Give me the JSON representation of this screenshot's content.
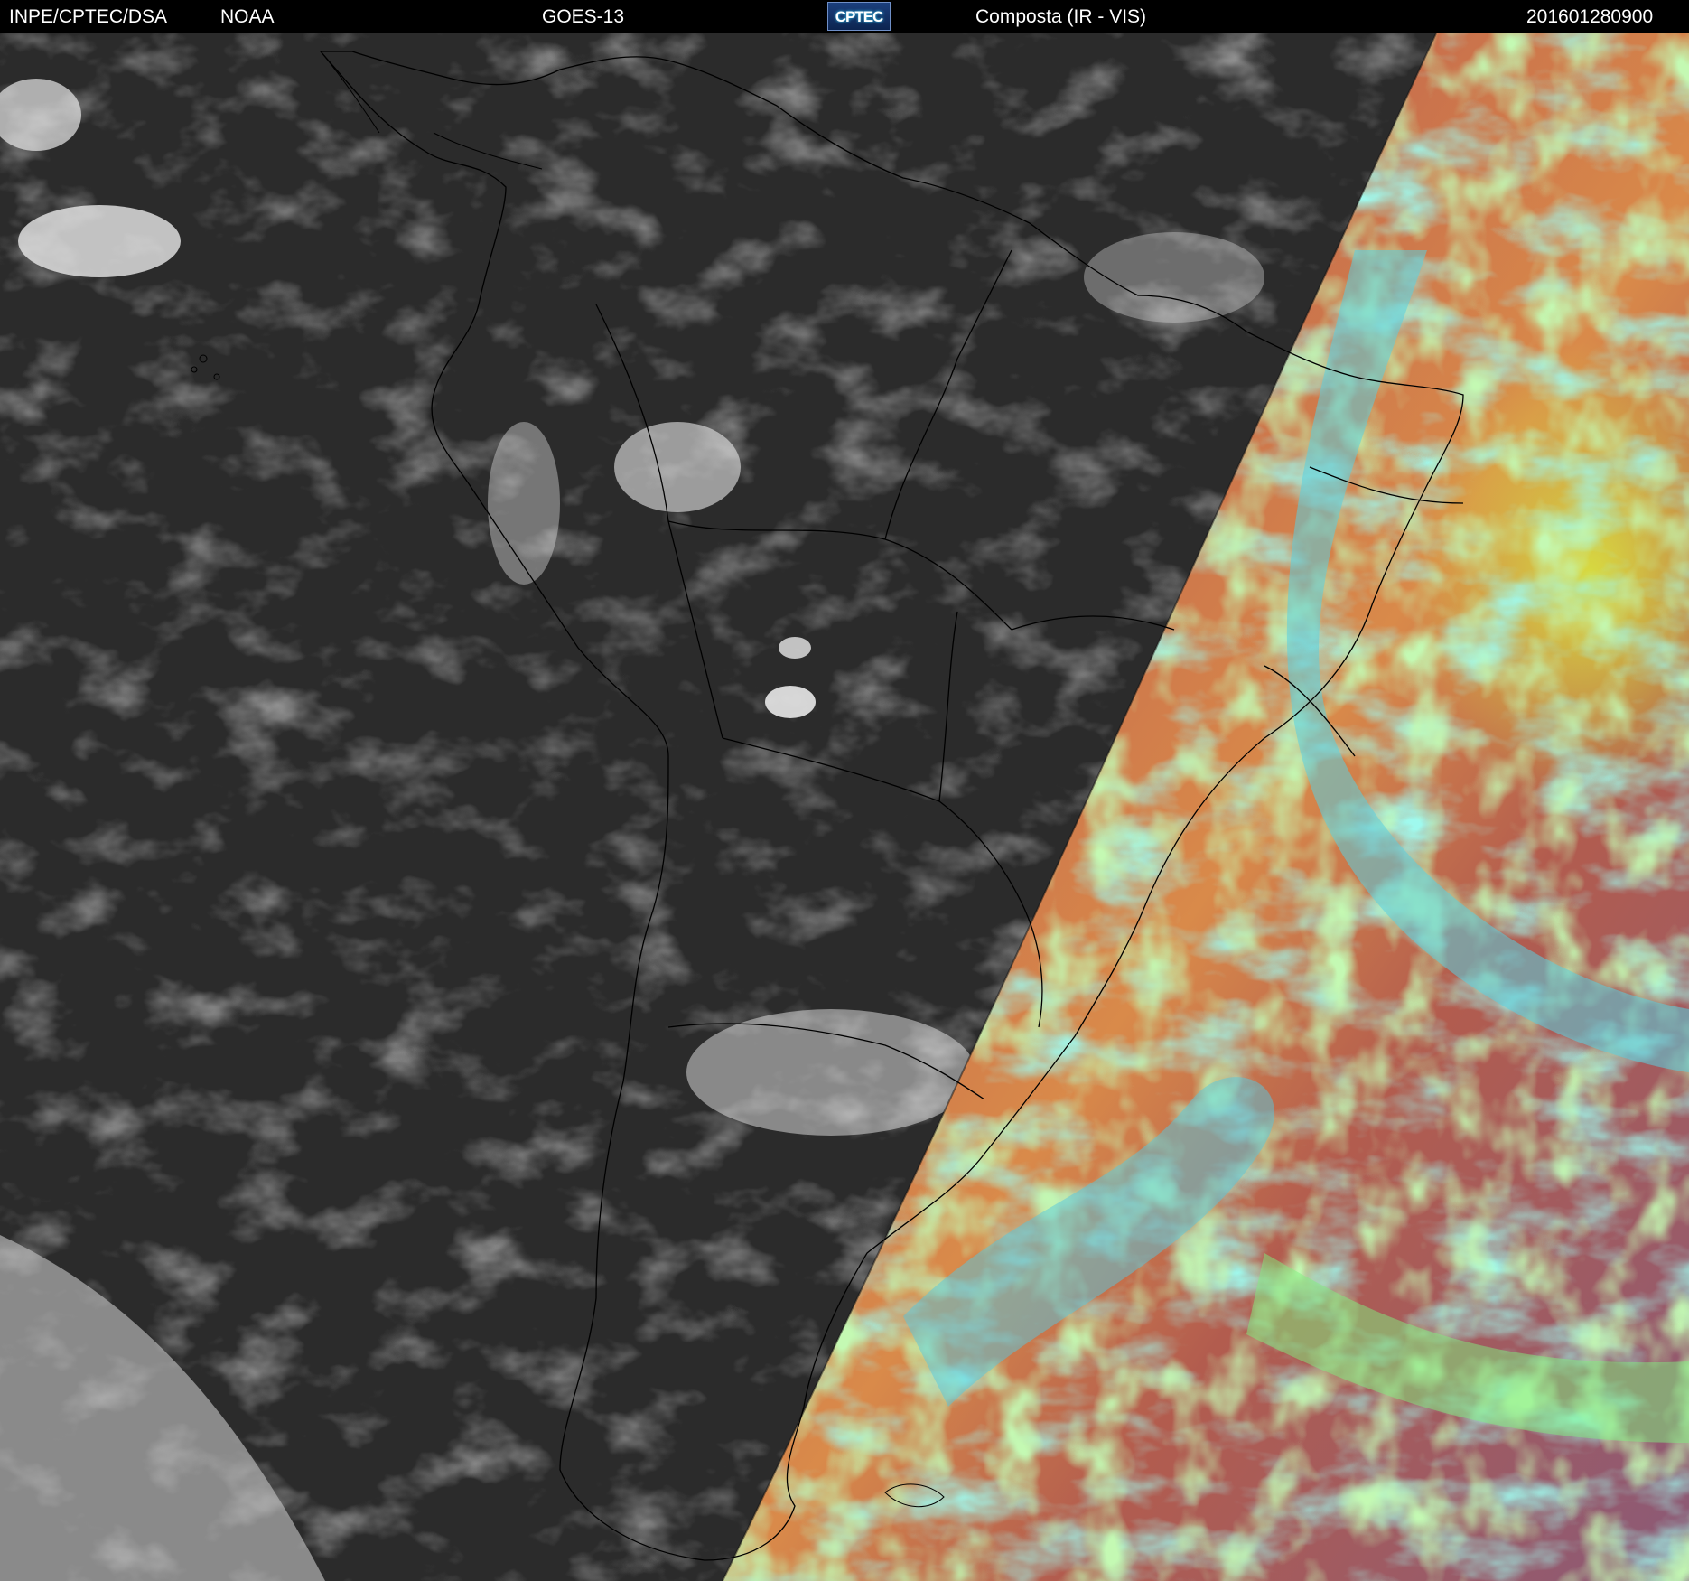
{
  "header": {
    "org": "INPE/CPTEC/DSA",
    "agency": "NOAA",
    "satellite": "GOES-13",
    "logo_text": "CPTEC",
    "product": "Composta (IR - VIS)",
    "timestamp": "201601280900"
  },
  "colors": {
    "header_bg": "#000000",
    "header_text": "#ffffff",
    "ir_background": "#2a2a2a",
    "vis_ocean": "#c46a4e",
    "vis_cloud_high": "#4fd8d8",
    "vis_cloud_low": "#7ef08a",
    "border_lines": "#000000"
  }
}
